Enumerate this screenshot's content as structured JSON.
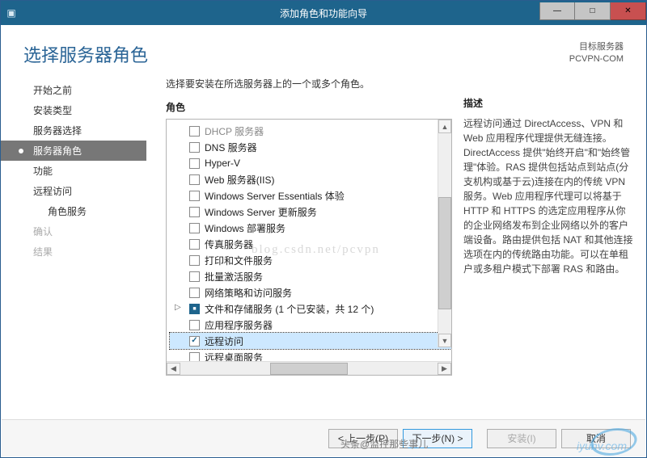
{
  "window": {
    "title": "添加角色和功能向导",
    "min": "—",
    "max": "□",
    "close": "✕"
  },
  "header": {
    "page_title": "选择服务器角色",
    "target_label": "目标服务器",
    "target_server": "PCVPN-COM"
  },
  "nav": {
    "items": [
      {
        "label": "开始之前",
        "state": ""
      },
      {
        "label": "安装类型",
        "state": ""
      },
      {
        "label": "服务器选择",
        "state": ""
      },
      {
        "label": "服务器角色",
        "state": "selected"
      },
      {
        "label": "功能",
        "state": ""
      },
      {
        "label": "远程访问",
        "state": ""
      },
      {
        "label": "角色服务",
        "state": "sub"
      },
      {
        "label": "确认",
        "state": "disabled"
      },
      {
        "label": "结果",
        "state": "disabled"
      }
    ]
  },
  "center": {
    "instruction": "选择要安装在所选服务器上的一个或多个角色。",
    "roles_title": "角色",
    "roles": [
      {
        "label": "DHCP 服务器",
        "checked": false,
        "cutoff": true
      },
      {
        "label": "DNS 服务器",
        "checked": false
      },
      {
        "label": "Hyper-V",
        "checked": false
      },
      {
        "label": "Web 服务器(IIS)",
        "checked": false
      },
      {
        "label": "Windows Server Essentials 体验",
        "checked": false
      },
      {
        "label": "Windows Server 更新服务",
        "checked": false
      },
      {
        "label": "Windows 部署服务",
        "checked": false
      },
      {
        "label": "传真服务器",
        "checked": false
      },
      {
        "label": "打印和文件服务",
        "checked": false
      },
      {
        "label": "批量激活服务",
        "checked": false
      },
      {
        "label": "网络策略和访问服务",
        "checked": false
      },
      {
        "label": "文件和存储服务 (1 个已安装，共 12 个)",
        "checked": "partial",
        "expander": "▷"
      },
      {
        "label": "应用程序服务器",
        "checked": false
      },
      {
        "label": "远程访问",
        "checked": true,
        "selected": true
      },
      {
        "label": "远程桌面服务",
        "checked": false
      }
    ]
  },
  "description": {
    "title": "描述",
    "text": "远程访问通过 DirectAccess、VPN 和 Web 应用程序代理提供无缝连接。DirectAccess 提供\"始终开启\"和\"始终管理\"体验。RAS 提供包括站点到站点(分支机构或基于云)连接在内的传统 VPN 服务。Web 应用程序代理可以将基于 HTTP 和 HTTPS 的选定应用程序从你的企业网络发布到企业网络以外的客户端设备。路由提供包括 NAT 和其他连接选项在内的传统路由功能。可以在单租户或多租户模式下部署 RAS 和路由。"
  },
  "footer": {
    "prev": "< 上一步(P)",
    "next": "下一步(N) >",
    "install": "安装(I)",
    "cancel": "取消"
  },
  "overlay": {
    "watermark": "blog.csdn.net/pcvpn",
    "attribution": "头条@监控那些事儿",
    "logo_text": "iyunv.com"
  }
}
